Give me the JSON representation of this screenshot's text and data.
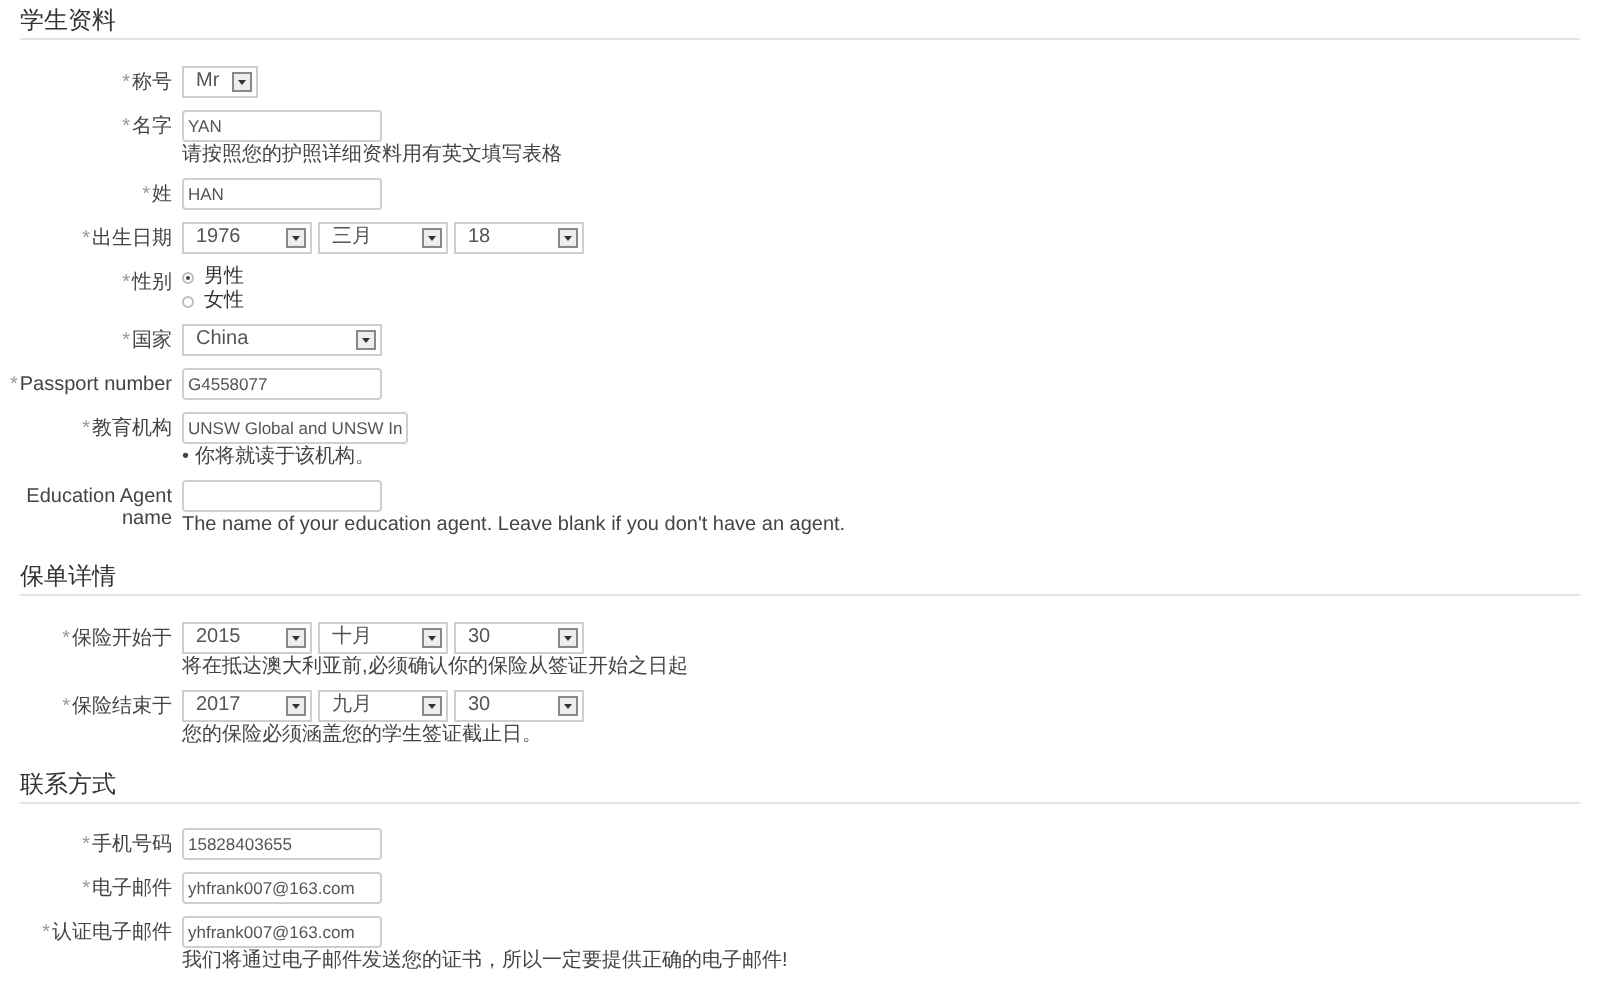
{
  "sections": [
    {
      "title": "学生资料",
      "fields": [
        {
          "kind": "picker",
          "mark": "*",
          "label": "称号",
          "value": "Mr"
        },
        {
          "kind": "text",
          "mark": "*",
          "label": "名字",
          "value": "YAN",
          "hint": "请按照您的护照详细资料用有英文填写表格"
        },
        {
          "kind": "text",
          "mark": "*",
          "label": "姓",
          "value": "HAN"
        },
        {
          "kind": "date",
          "mark": "*",
          "label": "出生日期",
          "parts": [
            "1976",
            "三月",
            "18"
          ]
        },
        {
          "kind": "radio",
          "mark": "*",
          "label": "性别",
          "options": [
            {
              "label": "男性",
              "selected": true
            },
            {
              "label": "女性",
              "selected": false
            }
          ]
        },
        {
          "kind": "select",
          "mark": "*",
          "label": "国家",
          "value": "China"
        },
        {
          "kind": "text",
          "mark": "*",
          "label": "Passport number",
          "value": "G4558077"
        },
        {
          "kind": "text",
          "mark": "*",
          "label": "教育机构",
          "value": "UNSW Global and UNSW In",
          "hint": "• 你将就读于该机构。"
        },
        {
          "kind": "text",
          "label": "Education Agent name",
          "hint": "The name of your education agent. Leave blank if you don't have an agent."
        }
      ]
    },
    {
      "title": "保单详情",
      "fields": [
        {
          "kind": "date",
          "mark": "*",
          "label": "保险开始于",
          "parts": [
            "2015",
            "十月",
            "30"
          ],
          "hint": "将在抵达澳大利亚前,必须确认你的保险从签证开始之日起"
        },
        {
          "kind": "date",
          "mark": "*",
          "label": "保险结束于",
          "parts": [
            "2017",
            "九月",
            "30"
          ],
          "hint": "您的保险必须涵盖您的学生签证截止日。"
        }
      ]
    },
    {
      "title": "联系方式",
      "fields": [
        {
          "kind": "text",
          "mark": "*",
          "label": "手机号码",
          "value": "15828403655"
        },
        {
          "kind": "text",
          "mark": "*",
          "label": "电子邮件",
          "value": "yhfrank007@163.com"
        },
        {
          "kind": "text",
          "mark": "*",
          "label": "认证电子邮件",
          "value": "yhfrank007@163.com",
          "hint": "我们将通过电子邮件发送您的证书，所以一定要提供正确的电子邮件!"
        }
      ]
    }
  ]
}
